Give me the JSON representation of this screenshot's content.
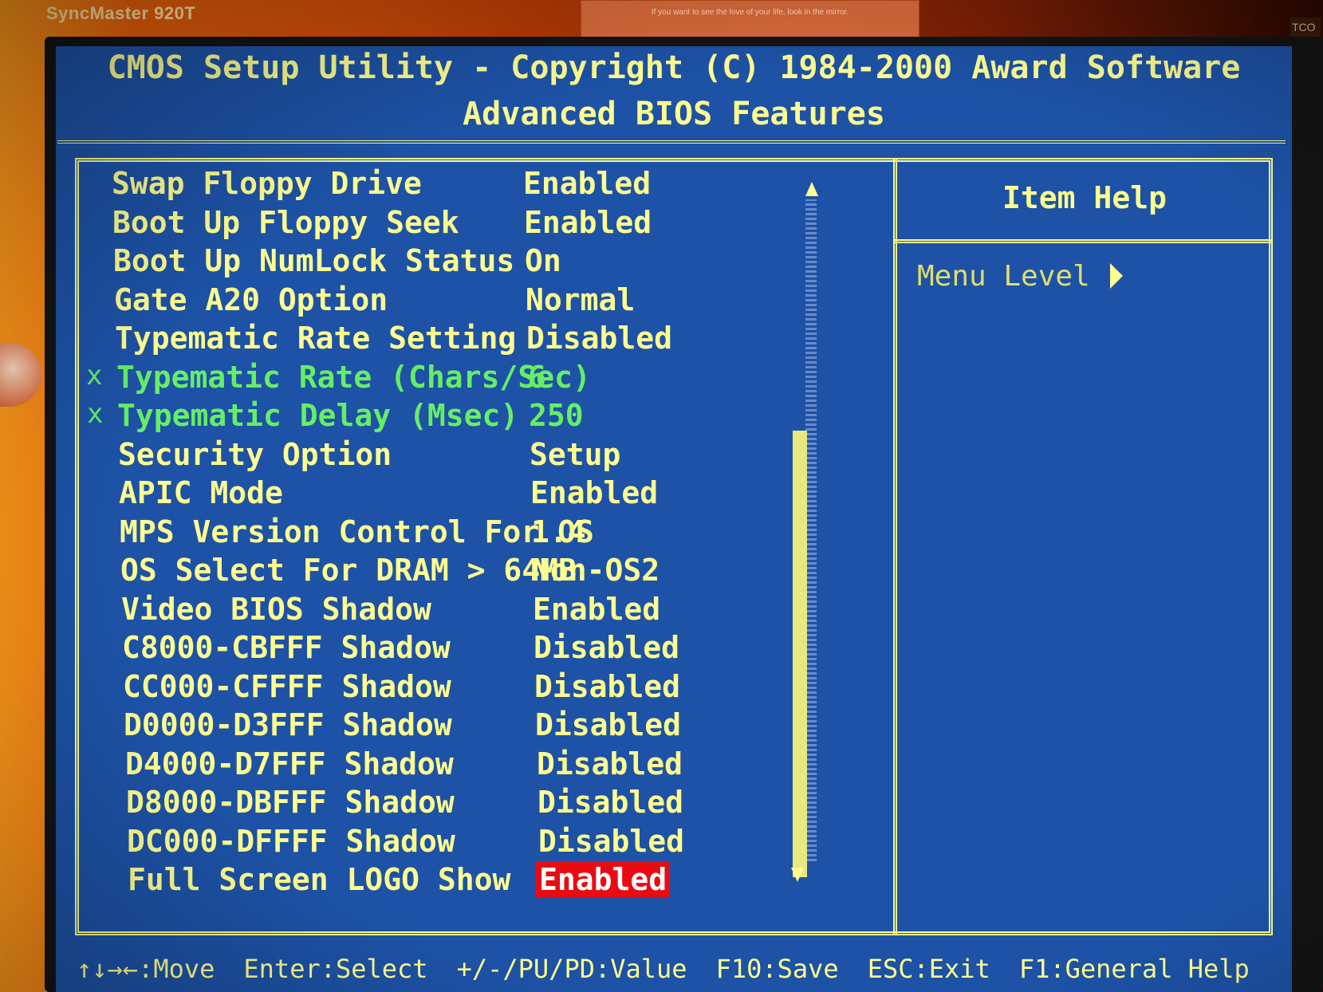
{
  "monitor": {
    "brand": "SyncMaster 920T",
    "sticky_note": "If you want to see the love of your life, look in the mirror.",
    "tag": "TCO"
  },
  "header": {
    "title": "CMOS Setup Utility - Copyright (C) 1984-2000 Award Software",
    "subtitle": "Advanced BIOS Features"
  },
  "help_panel": {
    "title": "Item Help",
    "menu_level_label": "Menu Level"
  },
  "settings": [
    {
      "label": "Swap Floppy Drive",
      "value": "Enabled",
      "mark": ""
    },
    {
      "label": "Boot Up Floppy Seek",
      "value": "Enabled",
      "mark": ""
    },
    {
      "label": "Boot Up NumLock Status",
      "value": "On",
      "mark": ""
    },
    {
      "label": "Gate A20 Option",
      "value": "Normal",
      "mark": ""
    },
    {
      "label": "Typematic Rate Setting",
      "value": "Disabled",
      "mark": ""
    },
    {
      "label": "Typematic Rate (Chars/Sec)",
      "value": "6",
      "mark": "x"
    },
    {
      "label": "Typematic Delay (Msec)",
      "value": "250",
      "mark": "x"
    },
    {
      "label": "Security Option",
      "value": "Setup",
      "mark": ""
    },
    {
      "label": "APIC Mode",
      "value": "Enabled",
      "mark": ""
    },
    {
      "label": "MPS Version Control For OS",
      "value": "1.4",
      "mark": ""
    },
    {
      "label": "OS Select For DRAM > 64MB",
      "value": "Non-OS2",
      "mark": ""
    },
    {
      "label": "Video BIOS Shadow",
      "value": "Enabled",
      "mark": ""
    },
    {
      "label": "C8000-CBFFF Shadow",
      "value": "Disabled",
      "mark": ""
    },
    {
      "label": "CC000-CFFFF Shadow",
      "value": "Disabled",
      "mark": ""
    },
    {
      "label": "D0000-D3FFF Shadow",
      "value": "Disabled",
      "mark": ""
    },
    {
      "label": "D4000-D7FFF Shadow",
      "value": "Disabled",
      "mark": ""
    },
    {
      "label": "D8000-DBFFF Shadow",
      "value": "Disabled",
      "mark": ""
    },
    {
      "label": "DC000-DFFFF Shadow",
      "value": "Disabled",
      "mark": ""
    },
    {
      "label": "Full Screen LOGO Show",
      "value": "Enabled",
      "mark": ""
    }
  ],
  "footer": {
    "move": "↑↓→←:Move",
    "select": "Enter:Select",
    "value": "+/-/PU/PD:Value",
    "save": "F10:Save",
    "exit": "ESC:Exit",
    "help": "F1:General Help"
  },
  "colors": {
    "screen_bg": "#1d52a6",
    "text": "#ffff90",
    "disabled_text": "#66ee66",
    "selection_bg": "#e80c12"
  },
  "icons": {
    "menu_level_arrow": "triangle-right-icon",
    "scroll_up": "triangle-up-icon",
    "scroll_down": "triangle-down-icon"
  }
}
